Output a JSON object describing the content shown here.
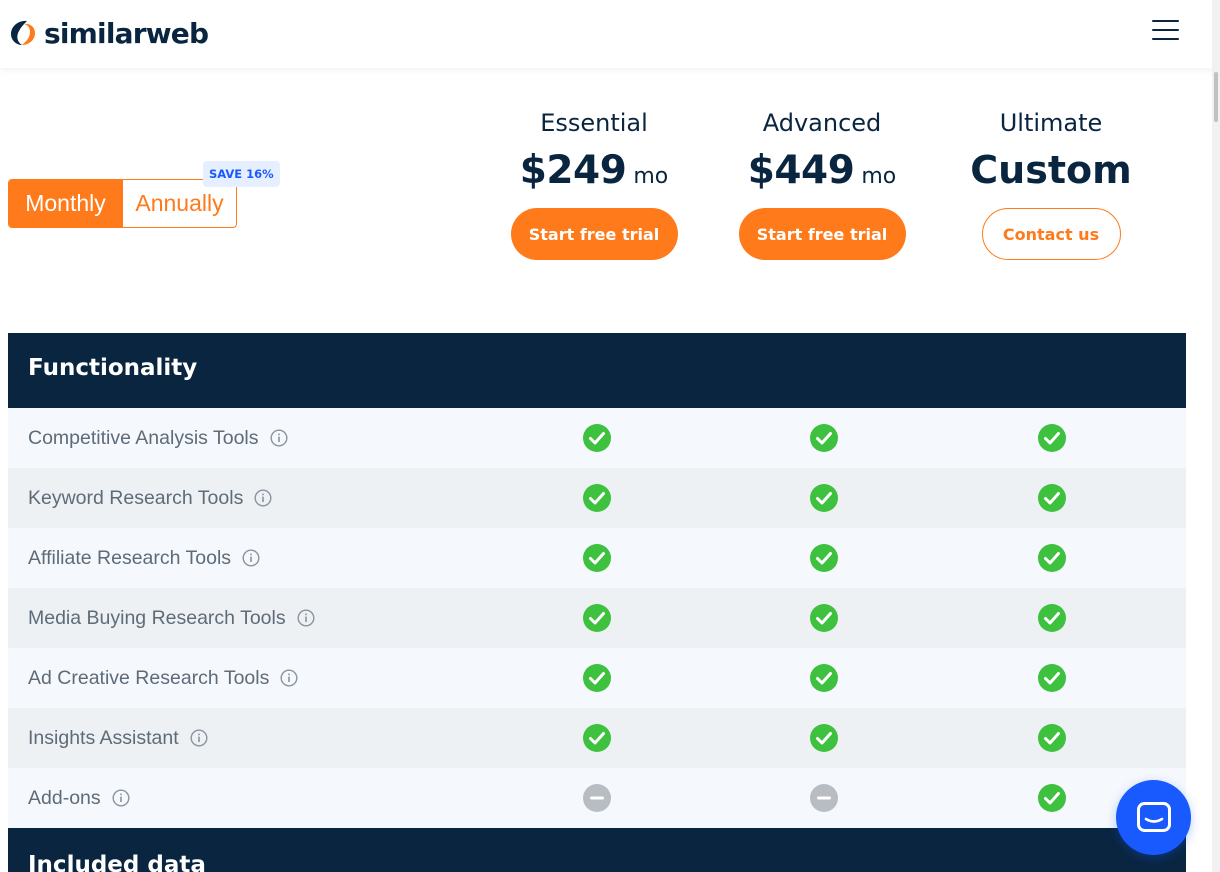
{
  "header": {
    "logo_text": "similarweb",
    "menu_icon": "hamburger-icon"
  },
  "billing": {
    "monthly_label": "Monthly",
    "annually_label": "Annually",
    "save_badge": "SAVE 16%",
    "selected": "Monthly"
  },
  "plans": [
    {
      "name": "Essential",
      "price": "$249",
      "unit": "mo",
      "cta": "Start free trial",
      "cta_style": "solid"
    },
    {
      "name": "Advanced",
      "price": "$449",
      "unit": "mo",
      "cta": "Start free trial",
      "cta_style": "solid"
    },
    {
      "name": "Ultimate",
      "price": "Custom",
      "unit": "",
      "cta": "Contact us",
      "cta_style": "outline"
    }
  ],
  "sections": [
    {
      "title": "Functionality",
      "rows": [
        {
          "label": "Competitive Analysis Tools",
          "values": [
            "check",
            "check",
            "check"
          ]
        },
        {
          "label": "Keyword Research Tools",
          "values": [
            "check",
            "check",
            "check"
          ]
        },
        {
          "label": "Affiliate Research Tools",
          "values": [
            "check",
            "check",
            "check"
          ]
        },
        {
          "label": "Media Buying Research Tools",
          "values": [
            "check",
            "check",
            "check"
          ]
        },
        {
          "label": "Ad Creative Research Tools",
          "values": [
            "check",
            "check",
            "check"
          ]
        },
        {
          "label": "Insights Assistant",
          "values": [
            "check",
            "check",
            "check"
          ]
        },
        {
          "label": "Add-ons",
          "values": [
            "dash",
            "dash",
            "check"
          ]
        }
      ]
    },
    {
      "title": "Included data",
      "rows": []
    }
  ],
  "colors": {
    "brand_orange": "#ff7a1a",
    "navy": "#092540",
    "check_green": "#3ec13e",
    "dash_gray": "#b8bdc4",
    "chat_blue": "#195afe"
  },
  "icons": {
    "check": "check-circle-icon",
    "dash": "minus-circle-icon",
    "info": "info-icon",
    "chat": "chat-icon"
  }
}
